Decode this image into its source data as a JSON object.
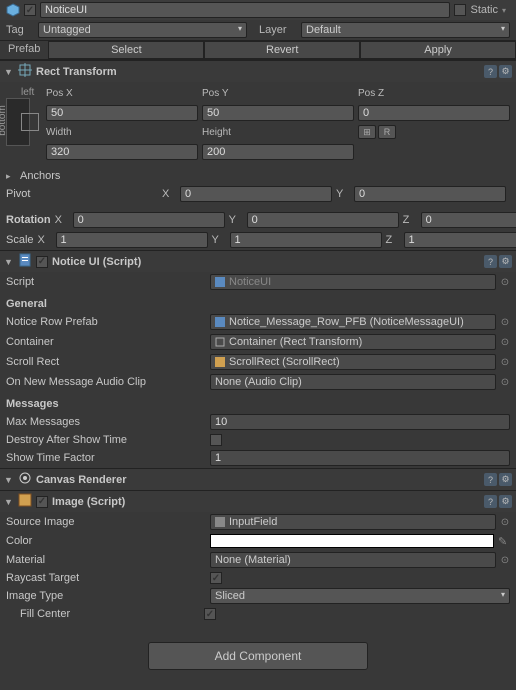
{
  "header": {
    "name": "NoticeUI",
    "active": true,
    "static_label": "Static",
    "static": false,
    "tag_label": "Tag",
    "tag_value": "Untagged",
    "layer_label": "Layer",
    "layer_value": "Default",
    "prefab_label": "Prefab",
    "prefab_buttons": {
      "select": "Select",
      "revert": "Revert",
      "apply": "Apply"
    }
  },
  "rect_transform": {
    "title": "Rect Transform",
    "anchor_top": "left",
    "anchor_left": "bottom",
    "posx_label": "Pos X",
    "posx": "50",
    "posy_label": "Pos Y",
    "posy": "50",
    "posz_label": "Pos Z",
    "posz": "0",
    "width_label": "Width",
    "width": "320",
    "height_label": "Height",
    "height": "200",
    "anchors_label": "Anchors",
    "pivot_label": "Pivot",
    "pivot_x": "0",
    "pivot_y": "0",
    "rotation_label": "Rotation",
    "rot_x": "0",
    "rot_y": "0",
    "rot_z": "0",
    "scale_label": "Scale",
    "scale_x": "1",
    "scale_y": "1",
    "scale_z": "1",
    "x": "X",
    "y": "Y",
    "z": "Z",
    "r_btn": "R"
  },
  "notice_ui": {
    "title": "Notice UI (Script)",
    "enabled": true,
    "script_label": "Script",
    "script_value": "NoticeUI",
    "general_label": "General",
    "row_prefab_label": "Notice Row Prefab",
    "row_prefab_value": "Notice_Message_Row_PFB (NoticeMessageUI)",
    "container_label": "Container",
    "container_value": "Container (Rect Transform)",
    "scroll_label": "Scroll Rect",
    "scroll_value": "ScrollRect (ScrollRect)",
    "audio_label": "On New Message Audio Clip",
    "audio_value": "None (Audio Clip)",
    "messages_label": "Messages",
    "max_label": "Max Messages",
    "max_value": "10",
    "destroy_label": "Destroy After Show Time",
    "destroy_value": false,
    "time_label": "Show Time Factor",
    "time_value": "1"
  },
  "canvas_renderer": {
    "title": "Canvas Renderer"
  },
  "image": {
    "title": "Image (Script)",
    "enabled": true,
    "source_label": "Source Image",
    "source_value": "InputField",
    "color_label": "Color",
    "material_label": "Material",
    "material_value": "None (Material)",
    "raycast_label": "Raycast Target",
    "raycast_value": true,
    "type_label": "Image Type",
    "type_value": "Sliced",
    "fill_label": "Fill Center",
    "fill_value": true
  },
  "add_component": "Add Component"
}
